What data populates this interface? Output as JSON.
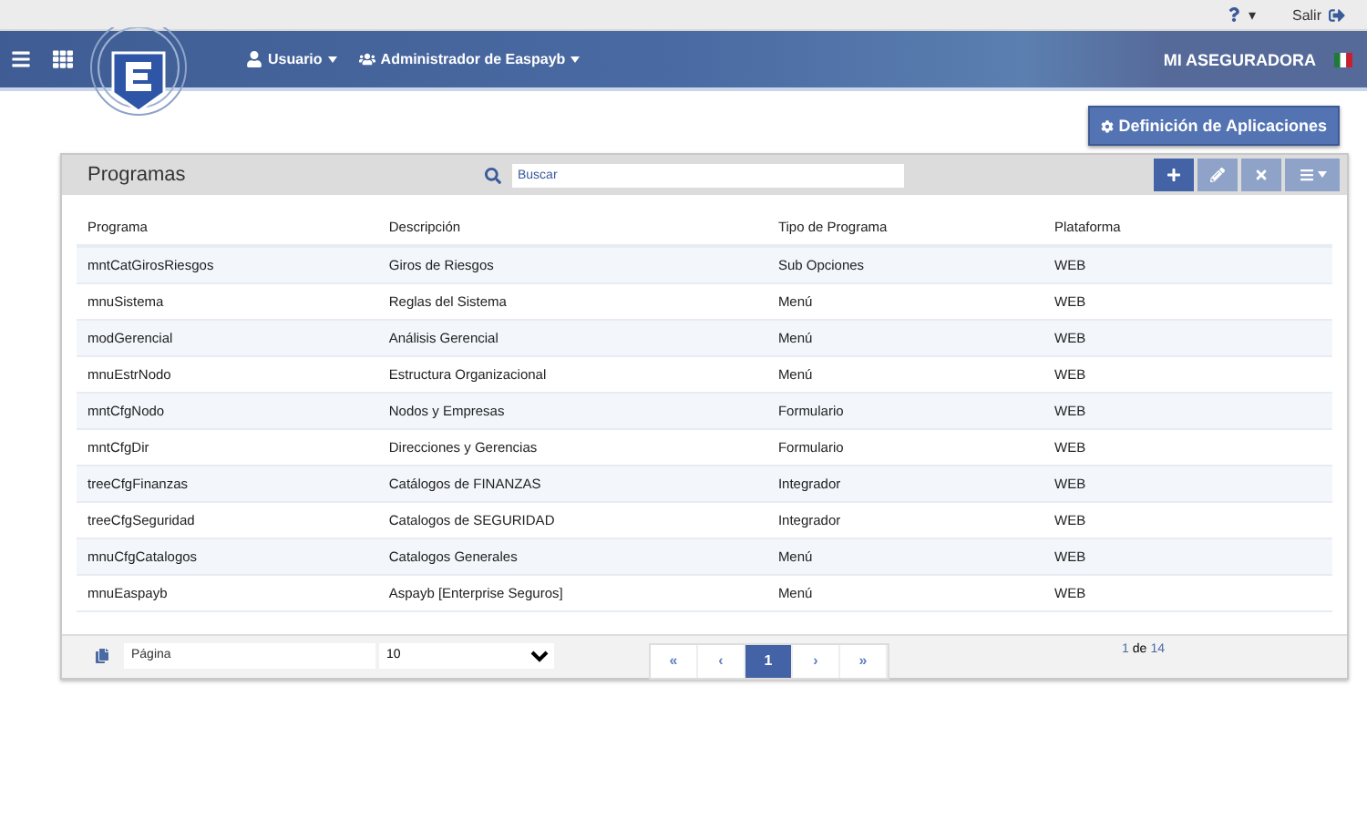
{
  "topbar": {
    "help_caret": "▾",
    "logout": "Salir"
  },
  "header": {
    "menus": [
      {
        "kind": "user",
        "label": "Usuario"
      },
      {
        "kind": "group",
        "label": "Administrador de Easpayb"
      }
    ],
    "company": "MI ASEGURADORA"
  },
  "action_button": "Definición de Aplicaciones",
  "panel": {
    "title": "Programas",
    "search": {
      "placeholder": "Buscar"
    },
    "tools": [
      {
        "kind": "add",
        "disabled": false
      },
      {
        "kind": "edit",
        "disabled": true
      },
      {
        "kind": "delete",
        "disabled": true
      },
      {
        "kind": "menu",
        "disabled": true
      }
    ],
    "table": {
      "columns": [
        "Programa",
        "Descripción",
        "Tipo de Programa",
        "Plataforma"
      ],
      "rows": [
        [
          "mntCatGirosRiesgos",
          "Giros de Riesgos",
          "Sub Opciones",
          "WEB"
        ],
        [
          "mnuSistema",
          "Reglas del Sistema",
          "Menú",
          "WEB"
        ],
        [
          "modGerencial",
          "Análisis Gerencial",
          "Menú",
          "WEB"
        ],
        [
          "mnuEstrNodo",
          "Estructura Organizacional",
          "Menú",
          "WEB"
        ],
        [
          "mntCfgNodo",
          "Nodos y Empresas",
          "Formulario",
          "WEB"
        ],
        [
          "mntCfgDir",
          "Direcciones y Gerencias",
          "Formulario",
          "WEB"
        ],
        [
          "treeCfgFinanzas",
          "Catálogos de FINANZAS",
          "Integrador",
          "WEB"
        ],
        [
          "treeCfgSeguridad",
          "Catalogos de SEGURIDAD",
          "Integrador",
          "WEB"
        ],
        [
          "mnuCfgCatalogos",
          "Catalogos Generales",
          "Menú",
          "WEB"
        ],
        [
          "mnuEaspayb",
          "Aspayb [Enterprise Seguros]",
          "Menú",
          "WEB"
        ]
      ]
    },
    "footer": {
      "page_placeholder": "Página",
      "page_size": "10",
      "pager": [
        {
          "label": "«",
          "selected": false
        },
        {
          "label": "‹",
          "selected": false
        },
        {
          "label": "1",
          "selected": true
        },
        {
          "label": "›",
          "selected": false
        },
        {
          "label": "»",
          "selected": false
        }
      ],
      "page_info": {
        "current": "1",
        "of": "de",
        "total": "14"
      }
    }
  }
}
